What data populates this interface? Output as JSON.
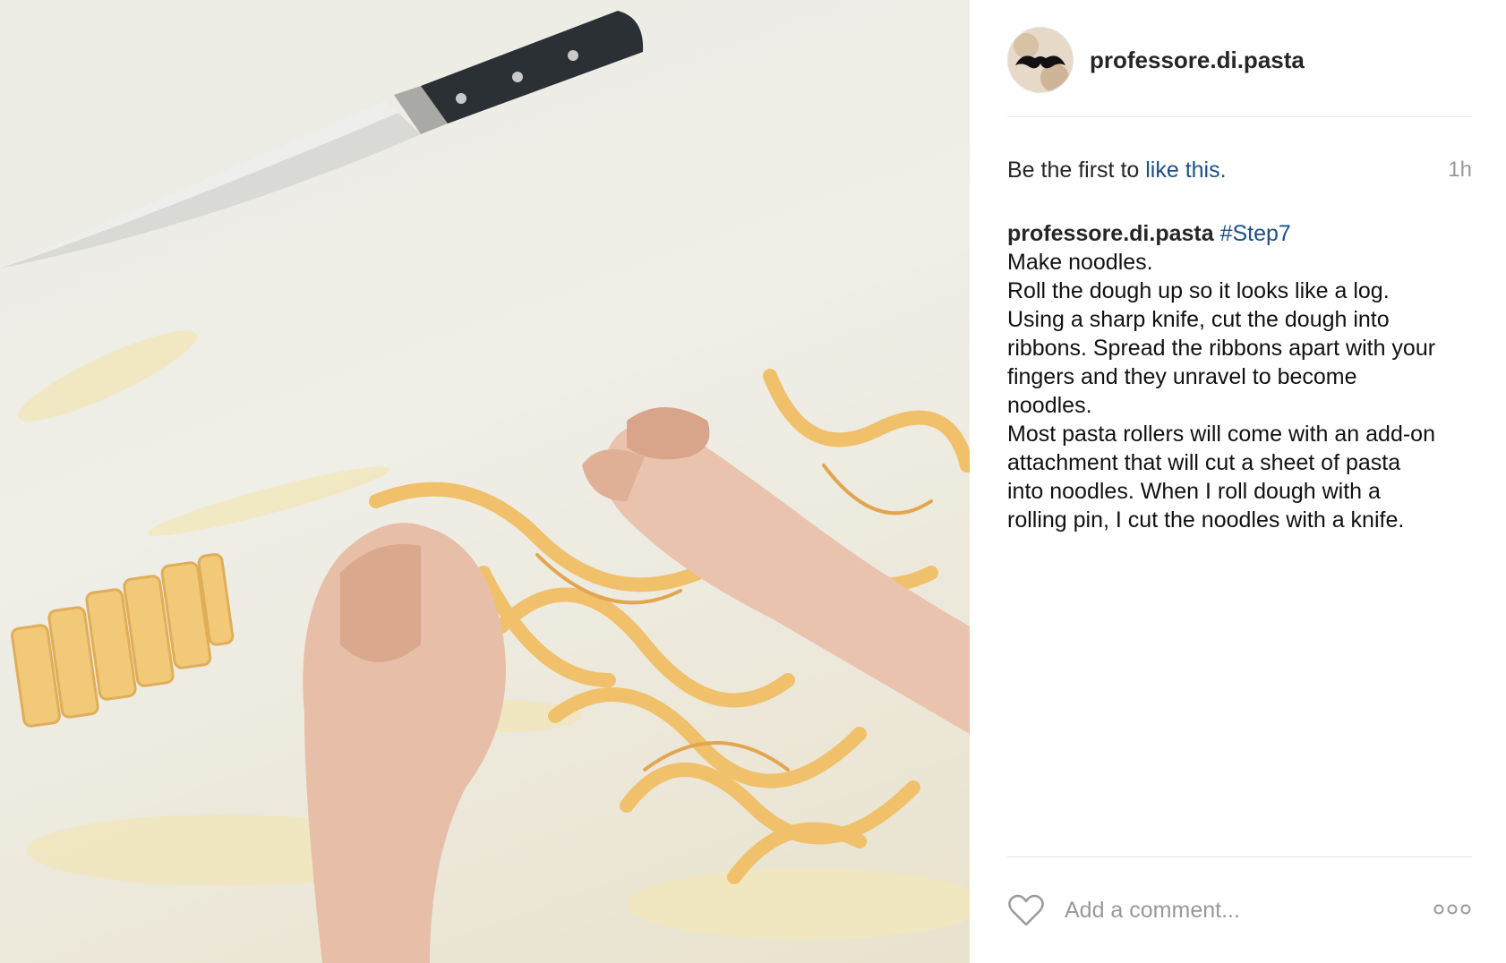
{
  "post": {
    "username": "professore.di.pasta",
    "likes": {
      "prefix": "Be the first to ",
      "link": "like this.",
      "time": "1h"
    },
    "caption": {
      "username": "professore.di.pasta",
      "hashtag": "#Step7",
      "lines": [
        "Make noodles.",
        "Roll the dough up so it looks like a log.",
        "Using a sharp knife, cut the dough into",
        "ribbons. Spread the ribbons apart with your",
        "fingers and they unravel to become",
        "noodles.",
        "Most pasta rollers will come with an add-on",
        "attachment that will cut a sheet of pasta",
        "into noodles. When I roll dough with a",
        "rolling pin, I cut the noodles with a knife."
      ]
    },
    "comment_placeholder": "Add a comment..."
  },
  "icons": {
    "avatar": "mustache-avatar",
    "like": "heart-outline-icon",
    "more": "more-options-icon"
  },
  "colors": {
    "link": "#1c4f88",
    "text": "#262626",
    "muted": "#999999",
    "divider": "#e6e6e6"
  }
}
